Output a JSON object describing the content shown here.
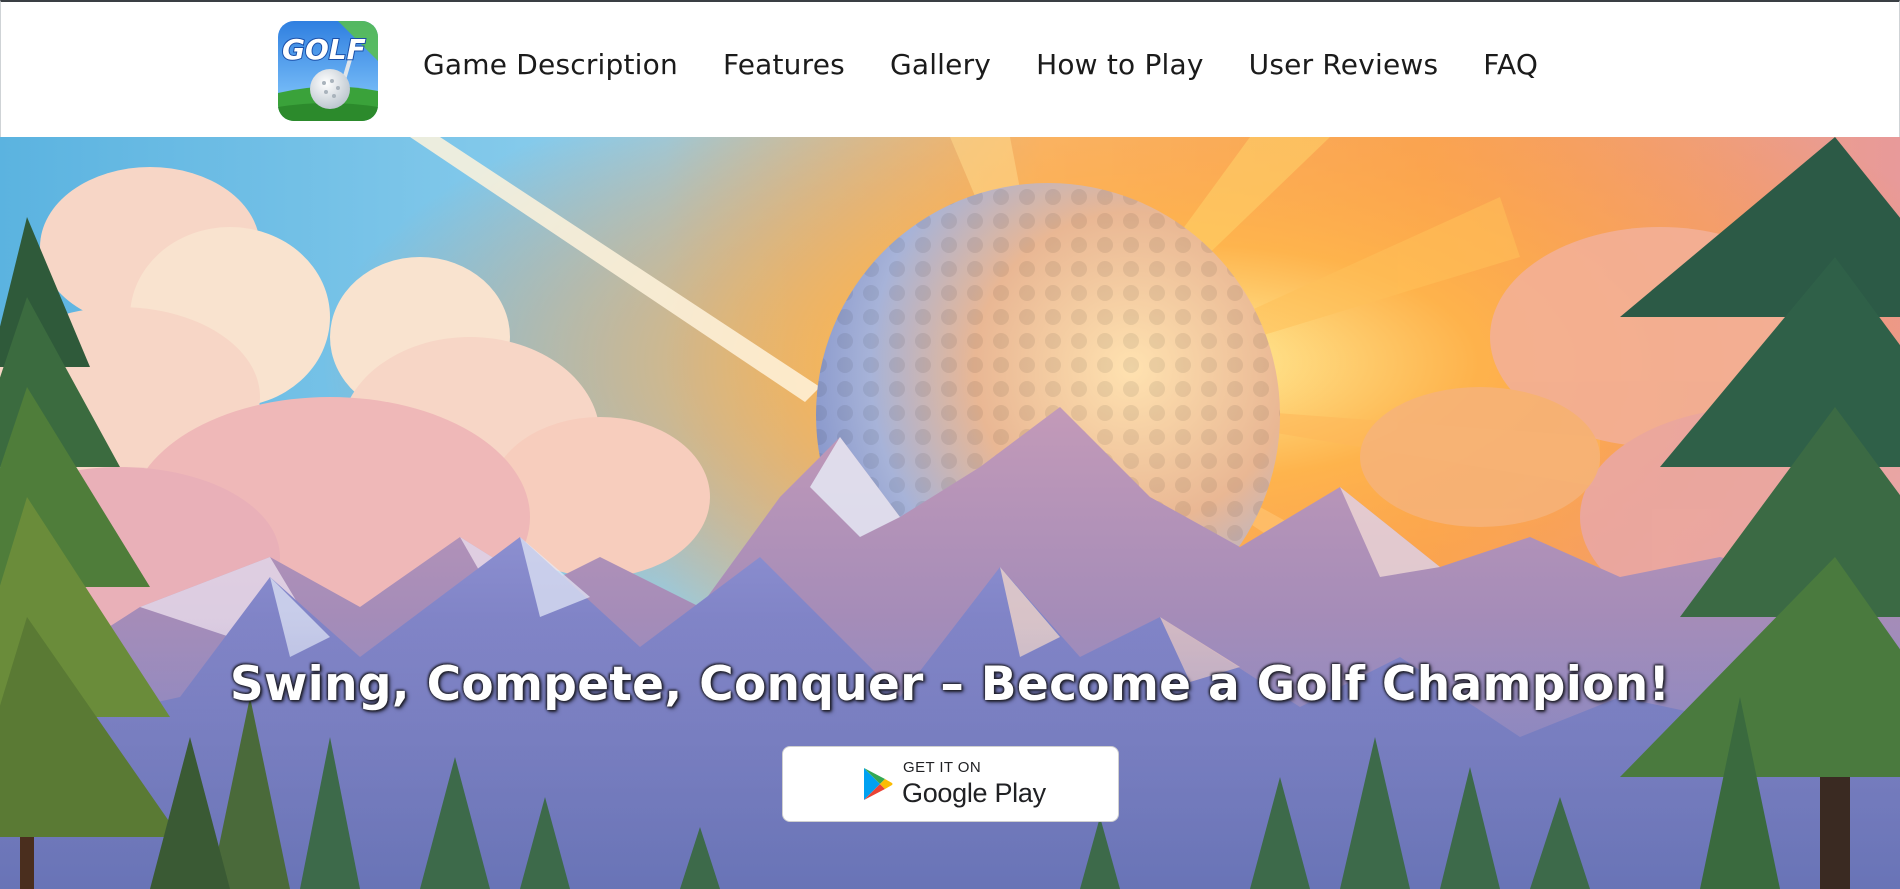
{
  "header": {
    "logo_text": "GOLF",
    "nav": [
      {
        "label": "Game Description"
      },
      {
        "label": "Features"
      },
      {
        "label": "Gallery"
      },
      {
        "label": "How to Play"
      },
      {
        "label": "User Reviews"
      },
      {
        "label": "FAQ"
      }
    ]
  },
  "hero": {
    "headline": "Swing, Compete, Conquer – Become a Golf Champion!",
    "badge": {
      "small_text": "GET IT ON",
      "big_text": "Google Play"
    }
  },
  "icons": {
    "logo": "golf-app-logo-icon",
    "play": "google-play-icon"
  },
  "colors": {
    "nav_text": "#1b1b1b",
    "header_bg": "#ffffff",
    "headline": "#ffffff"
  }
}
